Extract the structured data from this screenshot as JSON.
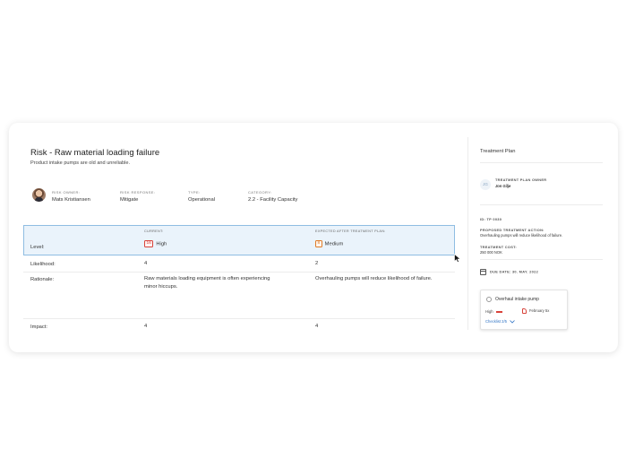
{
  "risk": {
    "title": "Risk - Raw material loading failure",
    "subtitle": "Product intake pumps are old and unreliable.",
    "meta": [
      {
        "label": "Risk owner:",
        "value": "Mats Kristiansen"
      },
      {
        "label": "Risk response:",
        "value": "Mitigate"
      },
      {
        "label": "Type:",
        "value": "Operational"
      },
      {
        "label": "Category:",
        "value": "2.2 - Facility Capacity"
      }
    ]
  },
  "table": {
    "headers": {
      "current": "Current:",
      "expected": "Expected after treatment plan:"
    },
    "level": {
      "label": "Level:",
      "current_score": "16",
      "current_text": "High",
      "expected_score": "8",
      "expected_text": "Medium"
    },
    "likelihood": {
      "label": "Likelihood:",
      "current": "4",
      "expected": "2"
    },
    "rationale": {
      "label": "Rationale:",
      "current": "Raw materials loading equipment is often experiencing minor hiccups.",
      "expected": "Overhauling pumps will reduce likelihood of failure."
    },
    "impact": {
      "label": "Impact:",
      "current": "4",
      "expected": "4"
    }
  },
  "treatment": {
    "title": "Treatment Plan",
    "owner_initials": "JG",
    "owner_label": "Treatment plan owner",
    "owner_name": "Jon Gilje",
    "id": "ID: TP 0030",
    "action_label": "Proposed treatment action:",
    "action_value": "Overhauling pumps will reduce likelihood of failure.",
    "cost_label": "Treatment cost:",
    "cost_value": "250 000 NOK",
    "due_date": "DUE DATE: 30. MAY. 2022",
    "task": {
      "title": "Overhaul intake pump",
      "priority": "High",
      "date": "February 5x",
      "checklist": "Checklist 2/5"
    }
  },
  "colors": {
    "selection_bg": "#eaf3fb",
    "selection_border": "#8fbde2",
    "high": "#d8433a",
    "medium": "#e07b27",
    "link": "#2d72c4"
  }
}
